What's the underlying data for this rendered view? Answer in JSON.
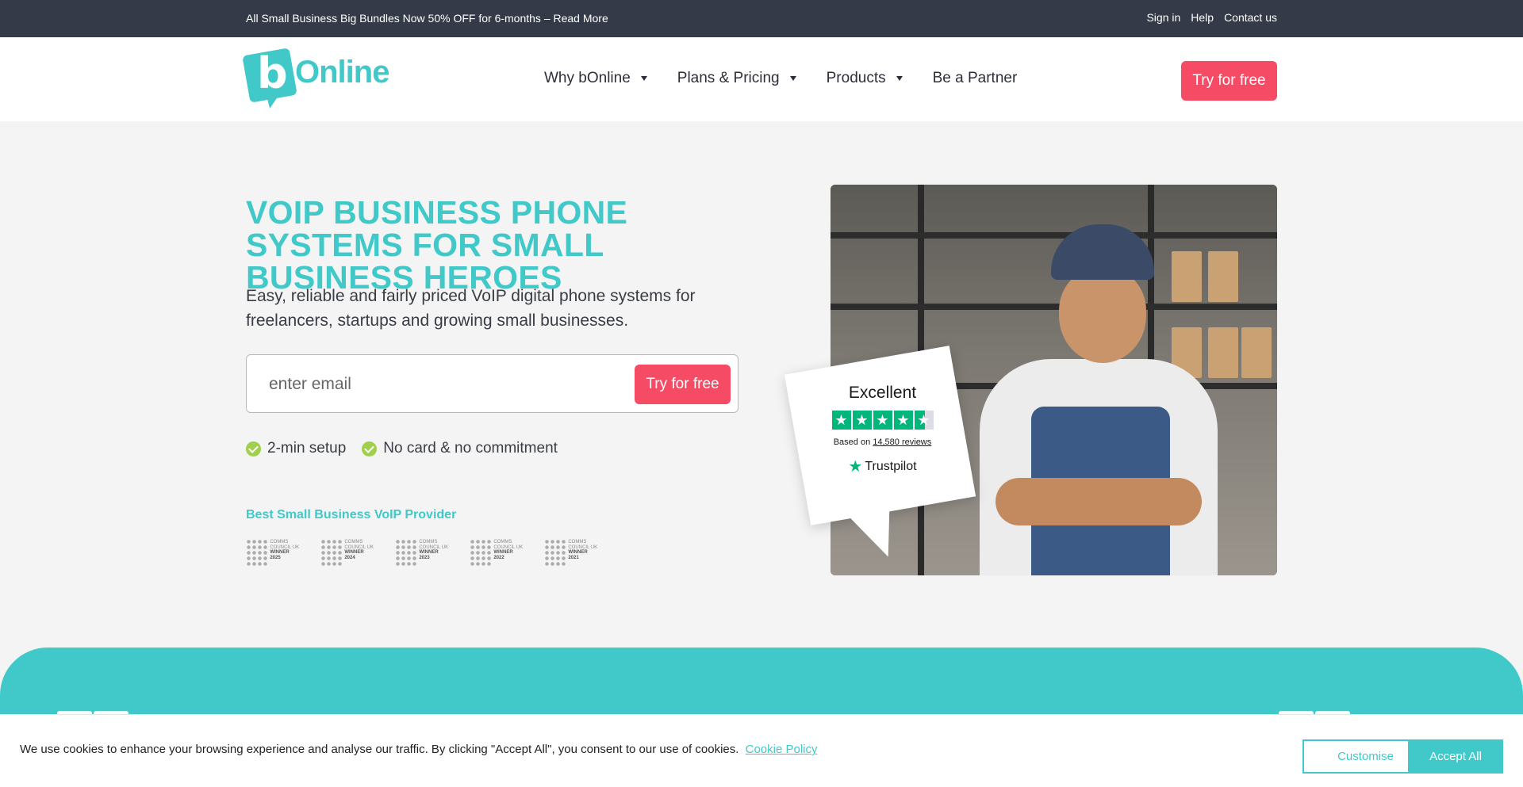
{
  "topbar": {
    "promo": "All Small Business Big Bundles Now 50% OFF for 6-months – Read More",
    "links": [
      "Sign in",
      "Help",
      "Contact us"
    ]
  },
  "header": {
    "logo_text": "Online",
    "logo_mark": "b",
    "nav": [
      {
        "label": "Why bOnline",
        "dropdown": true
      },
      {
        "label": "Plans & Pricing",
        "dropdown": true
      },
      {
        "label": "Products",
        "dropdown": true
      },
      {
        "label": "Be a Partner",
        "dropdown": false
      }
    ],
    "cta_label": "Try for free"
  },
  "hero": {
    "title": "VOIP BUSINESS PHONE SYSTEMS FOR SMALL BUSINESS HEROES",
    "subtitle": "Easy, reliable and fairly priced VoIP digital phone systems for freelancers, startups and growing small businesses.",
    "email_placeholder": "enter email",
    "cta_label": "Try for free",
    "checks": [
      "2-min setup",
      "No card & no commitment"
    ],
    "award_title": "Best Small Business VoIP Provider",
    "awards": [
      {
        "org": "COMMS COUNCIL UK",
        "label": "WINNER",
        "year": "2025"
      },
      {
        "org": "COMMS COUNCIL UK",
        "label": "WINNER",
        "year": "2024"
      },
      {
        "org": "COMMS COUNCIL UK",
        "label": "WINNER",
        "year": "2023"
      },
      {
        "org": "COMMS COUNCIL UK",
        "label": "WINNER",
        "year": "2022"
      },
      {
        "org": "COMMS COUNCIL UK",
        "label": "WINNER",
        "year": "2021"
      }
    ]
  },
  "trustpilot": {
    "rating_text": "Excellent",
    "stars": 4.5,
    "based_on": "Based on",
    "reviews": "14,580 reviews",
    "brand": "Trustpilot"
  },
  "cookie": {
    "message": "We use cookies to enhance your browsing experience and analyse our traffic. By clicking \"Accept All\", you consent to our use of cookies.",
    "policy_link": "Cookie Policy",
    "customise_label": "Customise",
    "accept_label": "Accept All"
  },
  "colors": {
    "brand_teal": "#41c9c9",
    "cta_pink": "#f54b65",
    "topbar_bg": "#343a48",
    "check_green": "#9fcf4c",
    "trustpilot_green": "#00b67a"
  }
}
